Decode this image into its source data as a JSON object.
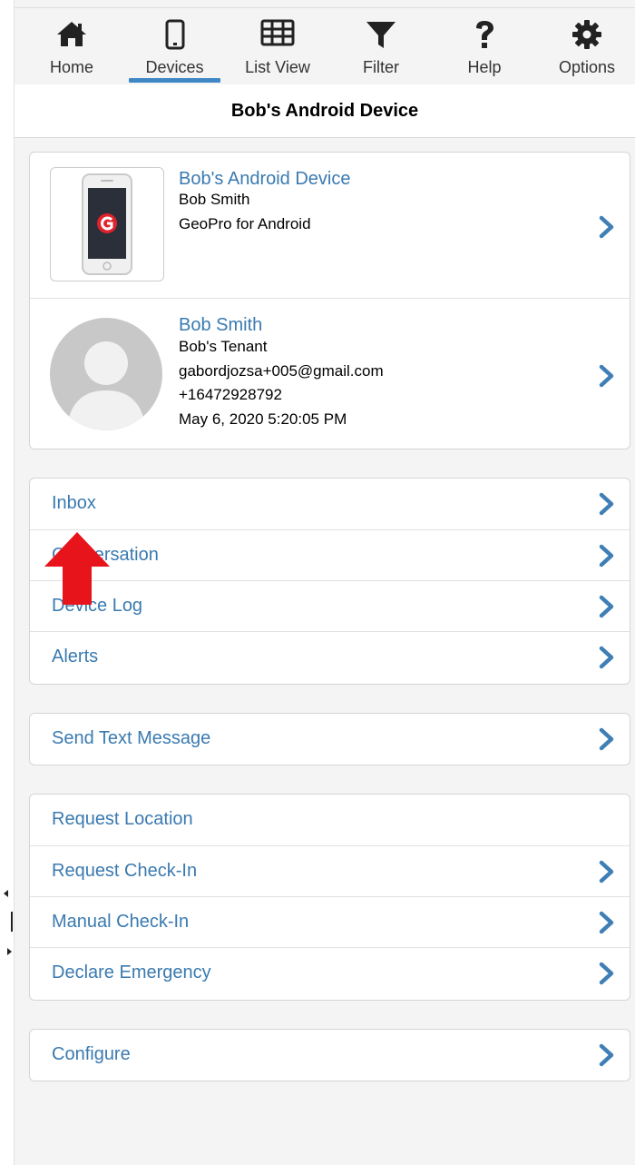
{
  "nav": {
    "items": [
      {
        "label": "Home",
        "icon": "home-icon"
      },
      {
        "label": "Devices",
        "icon": "phone-icon",
        "active": true
      },
      {
        "label": "List View",
        "icon": "table-grid-icon"
      },
      {
        "label": "Filter",
        "icon": "filter-funnel-icon"
      },
      {
        "label": "Help",
        "icon": "question-mark-icon"
      },
      {
        "label": "Options",
        "icon": "gear-icon"
      }
    ]
  },
  "page": {
    "title": "Bob's Android Device"
  },
  "device": {
    "name": "Bob's Android Device",
    "owner": "Bob Smith",
    "app": "GeoPro for Android"
  },
  "contact": {
    "name": "Bob Smith",
    "tenant": "Bob's Tenant",
    "email": "gabordjozsa+005@gmail.com",
    "phone": "+16472928792",
    "timestamp": "May 6, 2020 5:20:05 PM"
  },
  "groups": {
    "messages": [
      {
        "label": "Inbox"
      },
      {
        "label": "Conversation"
      },
      {
        "label": "Device Log"
      },
      {
        "label": "Alerts"
      }
    ],
    "send": [
      {
        "label": "Send Text Message"
      }
    ],
    "requests": [
      {
        "label": "Request Location"
      },
      {
        "label": "Request Check-In"
      },
      {
        "label": "Manual Check-In"
      },
      {
        "label": "Declare Emergency"
      }
    ],
    "configure": [
      {
        "label": "Configure"
      }
    ]
  },
  "colors": {
    "accent": "#3f88c5",
    "link": "#3a7ab0",
    "chevron": "#3f7fb5",
    "annotation": "#e8141c"
  }
}
